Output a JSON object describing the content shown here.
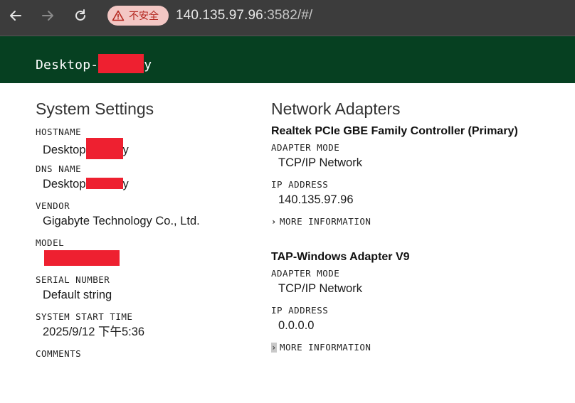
{
  "browser": {
    "security_label": "不安全",
    "url_host": "140.135.97.96",
    "url_rest": ":3582/#/"
  },
  "app": {
    "title_prefix": "Desktop-",
    "title_suffix": "y"
  },
  "system_settings": {
    "heading": "System Settings",
    "hostname_label": "HOSTNAME",
    "hostname_prefix": "Desktop",
    "hostname_suffix": "y",
    "dns_label": "DNS NAME",
    "dns_prefix": "Desktop",
    "dns_suffix": "y",
    "vendor_label": "VENDOR",
    "vendor_value": "Gigabyte Technology Co., Ltd.",
    "model_label": "MODEL",
    "serial_label": "SERIAL NUMBER",
    "serial_value": "Default string",
    "start_label": "SYSTEM START TIME",
    "start_value": "2025/9/12 下午5:36",
    "comments_label": "COMMENTS"
  },
  "network": {
    "heading": "Network Adapters",
    "adapters": [
      {
        "name": "Realtek PCIe GBE Family Controller (Primary)",
        "mode_label": "ADAPTER MODE",
        "mode_value": "TCP/IP Network",
        "ip_label": "IP ADDRESS",
        "ip_value": "140.135.97.96",
        "more_label": "MORE INFORMATION"
      },
      {
        "name": "TAP-Windows Adapter V9",
        "mode_label": "ADAPTER MODE",
        "mode_value": "TCP/IP Network",
        "ip_label": "IP ADDRESS",
        "ip_value": "0.0.0.0",
        "more_label": "MORE INFORMATION"
      }
    ]
  },
  "colors": {
    "chrome": "#3c3c3c",
    "header": "#064021",
    "redaction": "#ee2030"
  }
}
